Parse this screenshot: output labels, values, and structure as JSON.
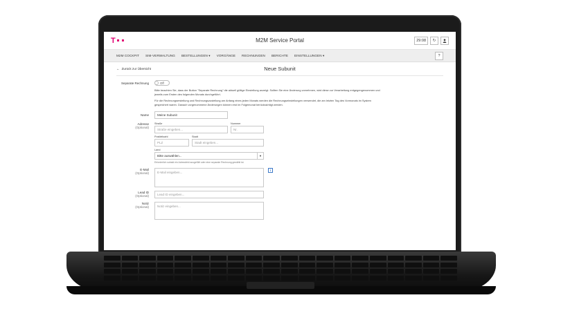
{
  "app": {
    "title": "M2M Service Portal",
    "session_time": "29:08"
  },
  "nav": {
    "items": [
      "M2M Cockpit",
      "SIM-Verwaltung",
      "Bestellungen ▾",
      "Vorgänge",
      "Rechnungen",
      "Berichte",
      "Einstellungen ▾"
    ],
    "help": "?"
  },
  "page": {
    "back_label": "Zurück zur Übersicht",
    "title": "Neue Subunit"
  },
  "form": {
    "separate_invoice": {
      "label": "Separate Rechnung",
      "state": "Off",
      "info_1": "Bitte beachten Sie, dass der Button \"Separate Rechnung\" die aktuell gültige Einstellung anzeigt. Sollten Sie eine Änderung vornehmen, wird diese zur Verarbeitung entgegengenommen und jeweils zum Ersten des folgenden Monats durchgeführt.",
      "info_2": "Für die Rechnungserstellung und Rechnungszustellung am Anfang eines jeden Monats werden die Rechnungseinstellungen verwendet, die am letzten Tag des Vormonats im System gespeichert waren. Danach vorgenommene Änderungen können erst im Folgemonat berücksichtigt werden."
    },
    "name": {
      "label": "Name",
      "value": "Meine Subunit"
    },
    "address": {
      "label": "Adresse",
      "optional": "(Optional)",
      "street_label": "Straße",
      "street_placeholder": "Straße eingeben...",
      "number_label": "Nummer",
      "number_placeholder": "Nr.",
      "zip_label": "Postleitzahl",
      "zip_placeholder": "PLZ",
      "city_label": "Stadt",
      "city_placeholder": "Stadt eingeben...",
      "country_label": "Land",
      "country_placeholder": "Bitte auswählen...",
      "help": "Erforderlich sobald ein Adressfeld ausgefüllt oder eine separate Rechnung gewählt ist."
    },
    "email": {
      "label": "E-Mail",
      "optional": "(Optional)",
      "placeholder": "E-Mail eingeben..."
    },
    "lead_id": {
      "label": "Lead ID",
      "optional": "(Optional)",
      "placeholder": "Lead ID eingeben..."
    },
    "notes": {
      "label": "Notiz",
      "optional": "(Optional)",
      "placeholder": "Notiz eingeben..."
    }
  },
  "colors": {
    "brand": "#e20074",
    "info": "#3a77c7"
  }
}
